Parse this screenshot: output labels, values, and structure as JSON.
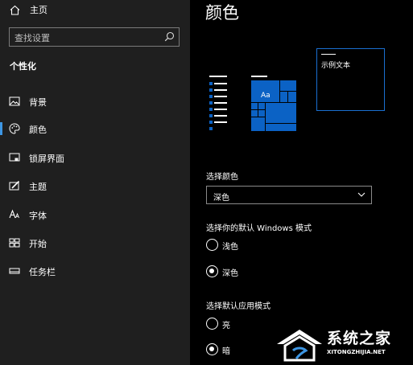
{
  "sidebar": {
    "home_label": "主页",
    "search_placeholder": "查找设置",
    "section_title": "个性化",
    "items": [
      {
        "label": "背景",
        "icon": "image-icon"
      },
      {
        "label": "颜色",
        "icon": "palette-icon",
        "selected": true
      },
      {
        "label": "锁屏界面",
        "icon": "lock-screen-icon"
      },
      {
        "label": "主题",
        "icon": "theme-brush-icon"
      },
      {
        "label": "字体",
        "icon": "font-icon"
      },
      {
        "label": "开始",
        "icon": "start-tiles-icon"
      },
      {
        "label": "任务栏",
        "icon": "taskbar-icon"
      }
    ]
  },
  "main": {
    "title": "颜色",
    "preview_tile_text": "Aa",
    "preview_sample_text": "示例文本",
    "choose_color": {
      "label": "选择颜色",
      "value": "深色"
    },
    "windows_mode": {
      "label": "选择你的默认 Windows 模式",
      "options": [
        {
          "label": "浅色",
          "selected": false
        },
        {
          "label": "深色",
          "selected": true
        }
      ]
    },
    "app_mode": {
      "label": "选择默认应用模式",
      "options": [
        {
          "label": "亮",
          "selected": false
        },
        {
          "label": "暗",
          "selected": true
        }
      ]
    }
  },
  "watermark": {
    "name": "系统之家",
    "url": "XITONGZHIJIA.NET"
  },
  "colors": {
    "accent": "#0b62c5",
    "accent_light": "#3d96e3",
    "sidebar_bg": "#1f1f1f",
    "main_bg": "#000000"
  }
}
